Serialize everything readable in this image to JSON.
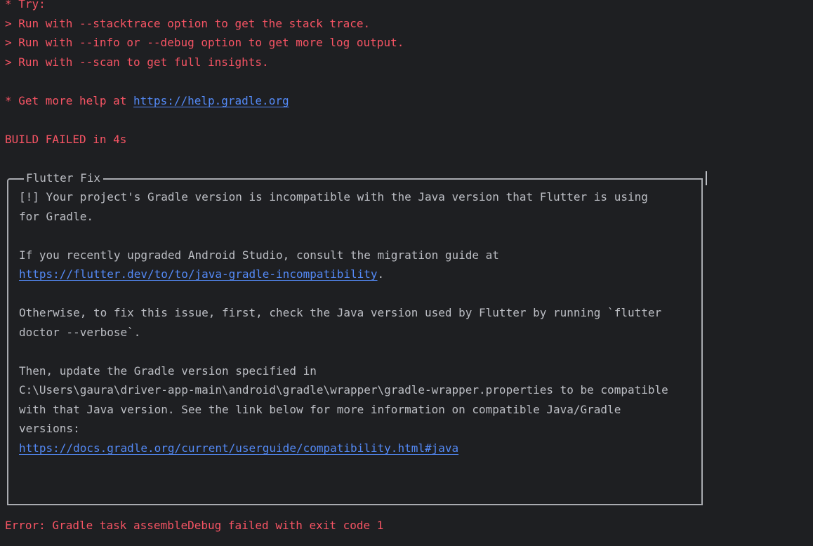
{
  "colors": {
    "background": "#1e1f22",
    "error_text": "#f75464",
    "normal_text": "#bcbec4",
    "link": "#548af7",
    "box_border": "#a9abb0"
  },
  "output": {
    "try_header": "* Try:",
    "try_items": [
      "> Run with --stacktrace option to get the stack trace.",
      "> Run with --info or --debug option to get more log output.",
      "> Run with --scan to get full insights."
    ],
    "help_prefix": "* Get more help at ",
    "help_link": "https://help.gradle.org",
    "build_status": "BUILD FAILED in 4s"
  },
  "flutter_fix": {
    "title": "Flutter Fix",
    "line1": "[!] Your project's Gradle version is incompatible with the Java version that Flutter is using",
    "line2": "for Gradle.",
    "line3": "If you recently upgraded Android Studio, consult the migration guide at",
    "migration_link": "https://flutter.dev/to/to/java-gradle-incompatibility",
    "migration_link_suffix": ".",
    "line5": "Otherwise, to fix this issue, first, check the Java version used by Flutter by running `flutter",
    "line6": "doctor --verbose`.",
    "line7": "Then, update the Gradle version specified in",
    "line8": "C:\\Users\\gaura\\driver-app-main\\android\\gradle\\wrapper\\gradle-wrapper.properties to be compatible",
    "line9": "with that Java version. See the link below for more information on compatible Java/Gradle",
    "line10": "versions:",
    "compat_link": "https://docs.gradle.org/current/userguide/compatibility.html#java"
  },
  "final_error": "Error: Gradle task assembleDebug failed with exit code 1"
}
